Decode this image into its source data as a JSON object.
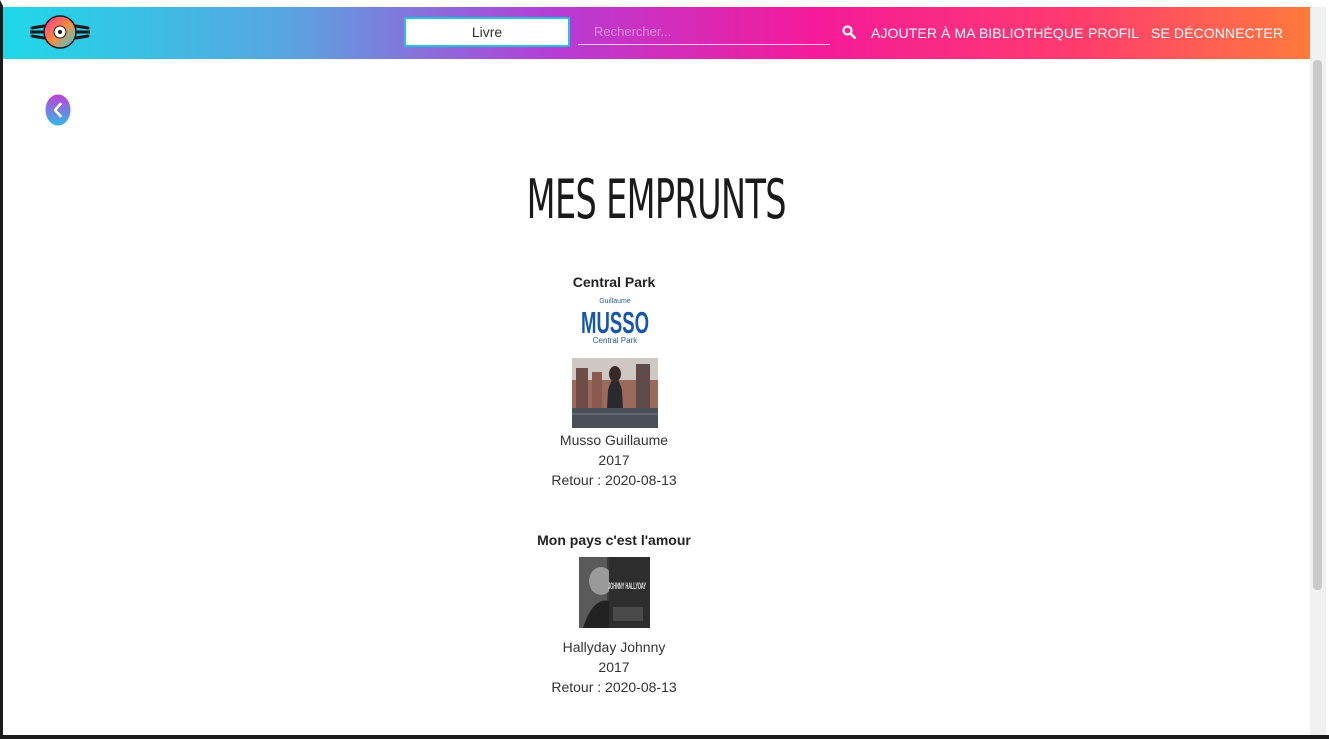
{
  "navbar": {
    "type_select": "Livre",
    "search_placeholder": "Rechercher...",
    "links": [
      "AJOUTER À MA BIBLIOTHÈQUE",
      "PROFIL",
      "SE DÉCONNECTER"
    ],
    "icons": {
      "logo": "vinyl-disc-logo",
      "search": "search-icon"
    },
    "gradient_colors": [
      "#1fd8e8",
      "#b53dd6",
      "#f51a9a",
      "#ff7a3d"
    ]
  },
  "page": {
    "title": "MES EMPRUNTS",
    "back_icon": "chevron-left-icon"
  },
  "loans": [
    {
      "title": "Central Park",
      "cover_author": "Guillaume",
      "cover_name": "MUSSO",
      "cover_subtitle": "Central Park",
      "author": "Musso Guillaume",
      "year": "2017",
      "return": "Retour : 2020-08-13"
    },
    {
      "title": "Mon pays c'est l'amour",
      "cover_name": "JOHNNY HALLYDAY",
      "author": "Hallyday Johnny",
      "year": "2017",
      "return": "Retour : 2020-08-13"
    }
  ]
}
